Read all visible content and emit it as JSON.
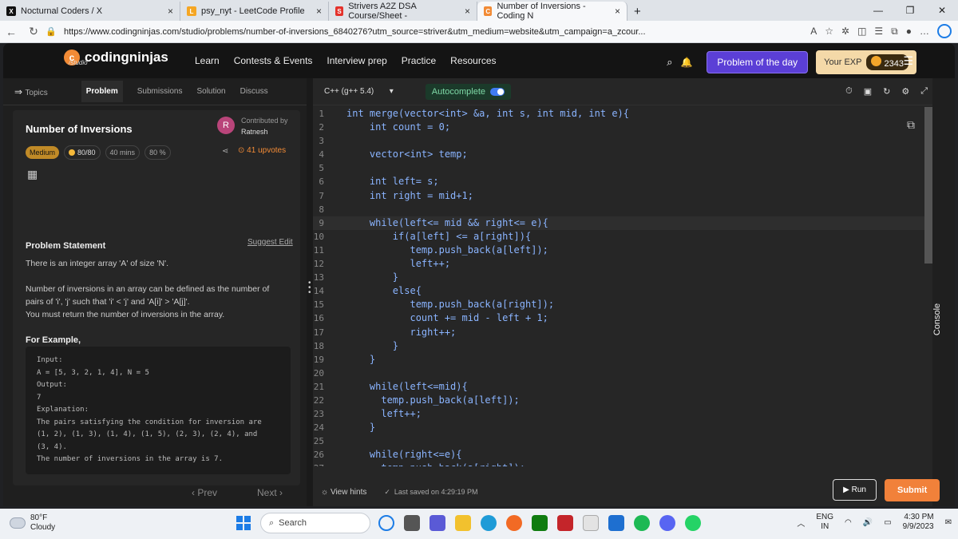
{
  "browser": {
    "tabs": [
      {
        "title": "Nocturnal Coders / X",
        "icon": "x-logo-icon",
        "color": "#111111"
      },
      {
        "title": "psy_nyt - LeetCode Profile",
        "icon": "leetcode-icon",
        "color": "#f5a623"
      },
      {
        "title": "Strivers A2Z DSA Course/Sheet -",
        "icon": "striver-icon",
        "color": "#e4322b"
      },
      {
        "title": "Number of Inversions - Coding N",
        "icon": "codingninjas-icon",
        "color": "#f28b36"
      }
    ],
    "new_tab": "+",
    "url": "https://www.codingninjas.com/studio/problems/number-of-inversions_6840276?utm_source=striver&utm_medium=website&utm_campaign=a_zcour..."
  },
  "site": {
    "logo": "codingninjas",
    "logo_sub": "/studio",
    "nav": [
      "Learn",
      "Contests & Events",
      "Interview prep",
      "Practice",
      "Resources"
    ],
    "potd": "Problem of the day",
    "exp_label": "Your EXP",
    "exp_value": "2343"
  },
  "left": {
    "topics": "Topics",
    "tabs": [
      "Problem",
      "Submissions",
      "Solution",
      "Discuss"
    ],
    "title": "Number of Inversions",
    "contributed_by": "Contributed by",
    "author": "Ratnesh",
    "avatar_letter": "R",
    "difficulty": "Medium",
    "score": "80/80",
    "time": "40 mins",
    "accuracy": "80 %",
    "upvotes": "41 upvotes",
    "statement_heading": "Problem Statement",
    "suggest_edit": "Suggest Edit",
    "statement_1": "There is an integer array 'A' of size 'N'.",
    "statement_2": "Number of inversions in an array can be defined as the number of pairs of 'i', 'j' such that 'i' < 'j' and 'A[i]' > 'A[j]'.",
    "statement_3": "You must return the number of inversions in the array.",
    "example_heading": "For Example,",
    "example_lines": [
      "Input:",
      "A = [5, 3, 2, 1, 4], N = 5",
      "Output:",
      "7",
      "Explanation:",
      "The pairs satisfying the condition for inversion are",
      "(1, 2), (1, 3), (1, 4), (1, 5), (2, 3), (2, 4), and",
      "(3, 4).",
      "The number of inversions in the array is 7."
    ],
    "prev": "‹ Prev",
    "next": "Next ›"
  },
  "editor": {
    "language": "C++ (g++ 5.4)",
    "autocomplete": "Autocomplete",
    "code_lines": [
      "int merge(vector<int> &a, int s, int mid, int e){",
      "    int count = 0;",
      "",
      "    vector<int> temp;",
      "",
      "    int left= s;",
      "    int right = mid+1;",
      "",
      "    while(left<= mid && right<= e){",
      "        if(a[left] <= a[right]){",
      "           temp.push_back(a[left]);",
      "           left++;",
      "        }",
      "        else{",
      "           temp.push_back(a[right]);",
      "           count += mid - left + 1;",
      "           right++;",
      "        }",
      "    }",
      "",
      "    while(left<=mid){",
      "      temp.push_back(a[left]);",
      "      left++;",
      "    }",
      "",
      "    while(right<=e){",
      "      temp.push_back(a[right]);"
    ],
    "view_hints": "View hints",
    "last_saved": "Last saved on 4:29:19 PM",
    "run": "Run",
    "submit": "Submit",
    "console": "Console"
  },
  "taskbar": {
    "temp": "80°F",
    "weather": "Cloudy",
    "search": "Search",
    "lang_1": "ENG",
    "lang_2": "IN",
    "time": "4:30 PM",
    "date": "9/9/2023"
  }
}
